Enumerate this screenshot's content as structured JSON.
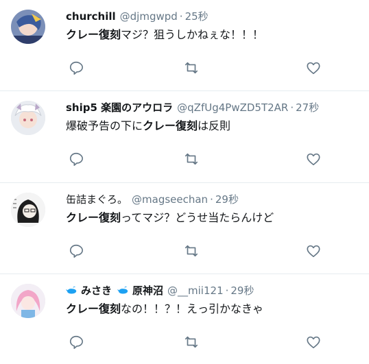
{
  "tweets": [
    {
      "name": "churchill",
      "handle": "@djmgwpd",
      "separator": "·",
      "time": "25秒",
      "body_bold": "クレー復刻",
      "body_pre": "",
      "body_post": "マジ？狙うしかねぇな！！！",
      "avatar": "avatar-anime-blue-hair"
    },
    {
      "name": "ship5 楽園のアウロラ",
      "handle": "@qZfUg4PwZD5T2AR",
      "separator": "·",
      "time": "27秒",
      "body_pre": "爆破予告の下に",
      "body_bold": "クレー復刻",
      "body_post": "は反則",
      "avatar": "avatar-anime-white-hair"
    },
    {
      "name": "缶詰まぐろ。",
      "handle": "@magseechan",
      "separator": "·",
      "time": "29秒",
      "body_pre": "",
      "body_bold": "クレー復刻",
      "body_post": "ってマジ？どうせ当たらんけど",
      "avatar": "avatar-dark-hair-glasses"
    },
    {
      "name_part1": "みさき",
      "name_part2": "原神沼",
      "handle": "@__mii121",
      "separator": "·",
      "time": "29秒",
      "body_pre": "",
      "body_bold": "クレー復刻",
      "body_post": "なの！！？！えっ引かなきゃ",
      "avatar": "avatar-anime-pink-hair",
      "name_icons": [
        "whale-emoji-icon",
        "whale-emoji-icon"
      ]
    }
  ],
  "actions": {
    "icons": [
      "reply-icon",
      "retweet-icon",
      "like-icon"
    ]
  },
  "colors": {
    "muted": "#657786",
    "text": "#14171a",
    "divider": "#e6ecf0",
    "whale": "#1da1f2"
  }
}
